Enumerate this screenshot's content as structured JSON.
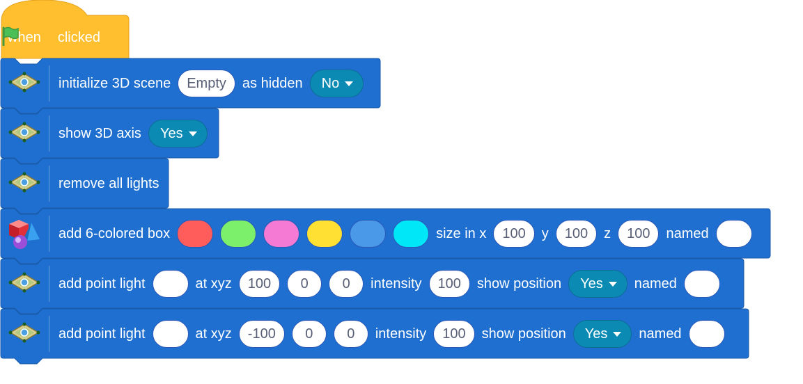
{
  "hat": {
    "label_when": "when",
    "label_clicked": "clicked",
    "flag_icon": "green-flag-icon",
    "color": "#ffbf2f"
  },
  "colors": {
    "block": "#1e6fd0",
    "block_dark": "#1a5aa8",
    "dropdown": "#0b8bb3"
  },
  "blocks": [
    {
      "icon": "3d-plate-icon",
      "text1": "initialize 3D scene",
      "input1": "Empty",
      "text2": "as hidden",
      "dropdown1": "No"
    },
    {
      "icon": "3d-plate-icon",
      "text1": "show 3D axis",
      "dropdown1": "Yes"
    },
    {
      "icon": "3d-plate-icon",
      "text1": "remove all lights"
    },
    {
      "icon": "3d-shapes-icon",
      "text1": "add 6-colored box",
      "swatches": [
        "#ff5c5c",
        "#7cf06a",
        "#f57ad4",
        "#ffe033",
        "#4a98e8",
        "#00e8f8"
      ],
      "text_size": "size in x",
      "x": "100",
      "text_y": "y",
      "y": "100",
      "text_z": "z",
      "z": "100",
      "text_named": "named",
      "name": ""
    },
    {
      "icon": "3d-plate-icon",
      "text1": "add point light",
      "color_input": "",
      "text_at": "at xyz",
      "x": "100",
      "y": "0",
      "z": "0",
      "text_intensity": "intensity",
      "intensity": "100",
      "text_show": "show position",
      "dropdown1": "Yes",
      "text_named": "named",
      "name": ""
    },
    {
      "icon": "3d-plate-icon",
      "text1": "add point light",
      "color_input": "",
      "text_at": "at xyz",
      "x": "-100",
      "y": "0",
      "z": "0",
      "text_intensity": "intensity",
      "intensity": "100",
      "text_show": "show position",
      "dropdown1": "Yes",
      "text_named": "named",
      "name": ""
    }
  ]
}
